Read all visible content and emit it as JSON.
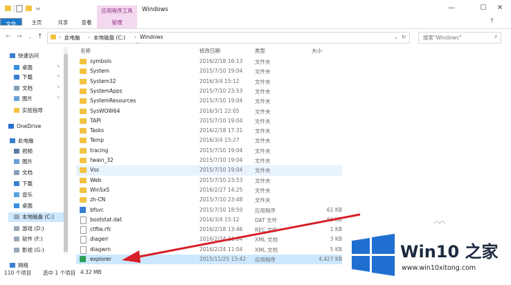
{
  "window": {
    "title": "Windows",
    "context_group": "应用程序工具",
    "minimize": "—",
    "maximize": "☐",
    "close": "✕"
  },
  "ribbon": {
    "tabs": [
      "文件",
      "主页",
      "共享",
      "查看",
      "管理"
    ]
  },
  "address": {
    "crumbs": [
      "此电脑",
      "本地磁盘 (C:)",
      "Windows"
    ],
    "search_placeholder": "搜索\"Windows\""
  },
  "nav": {
    "items": [
      {
        "label": "快速访问",
        "icon": "star-icon"
      },
      {
        "label": "桌面",
        "icon": "desktop-icon"
      },
      {
        "label": "下载",
        "icon": "download-icon"
      },
      {
        "label": "文档",
        "icon": "document-icon"
      },
      {
        "label": "图片",
        "icon": "picture-icon"
      },
      {
        "label": "实验指导",
        "icon": "folder-icon"
      },
      {
        "label": "OneDrive",
        "icon": "cloud-icon"
      },
      {
        "label": "此电脑",
        "icon": "computer-icon"
      },
      {
        "label": "视频",
        "icon": "video-icon"
      },
      {
        "label": "图片",
        "icon": "picture-icon"
      },
      {
        "label": "文档",
        "icon": "document-icon"
      },
      {
        "label": "下载",
        "icon": "download-icon"
      },
      {
        "label": "音乐",
        "icon": "music-icon"
      },
      {
        "label": "桌面",
        "icon": "desktop-icon"
      },
      {
        "label": "本地磁盘 (C:)",
        "icon": "drive-icon"
      },
      {
        "label": "游戏 (D:)",
        "icon": "drive-icon"
      },
      {
        "label": "软件 (F:)",
        "icon": "drive-icon"
      },
      {
        "label": "影视 (G:)",
        "icon": "drive-icon"
      },
      {
        "label": "网络",
        "icon": "network-icon"
      }
    ]
  },
  "columns": {
    "name": "名称",
    "date": "修改日期",
    "type": "类型",
    "size": "大小"
  },
  "files": [
    {
      "name": "symbols",
      "date": "2016/2/18 16:13",
      "type": "文件夹",
      "size": "",
      "kind": "folder"
    },
    {
      "name": "System",
      "date": "2015/7/10 19:04",
      "type": "文件夹",
      "size": "",
      "kind": "folder"
    },
    {
      "name": "System32",
      "date": "2016/3/4 15:12",
      "type": "文件夹",
      "size": "",
      "kind": "folder"
    },
    {
      "name": "SystemApps",
      "date": "2015/7/10 23:53",
      "type": "文件夹",
      "size": "",
      "kind": "folder"
    },
    {
      "name": "SystemResources",
      "date": "2015/7/10 19:04",
      "type": "文件夹",
      "size": "",
      "kind": "folder"
    },
    {
      "name": "SysWOW64",
      "date": "2016/3/1 22:05",
      "type": "文件夹",
      "size": "",
      "kind": "folder"
    },
    {
      "name": "TAPI",
      "date": "2015/7/10 19:04",
      "type": "文件夹",
      "size": "",
      "kind": "folder"
    },
    {
      "name": "Tasks",
      "date": "2016/2/18 17:31",
      "type": "文件夹",
      "size": "",
      "kind": "folder"
    },
    {
      "name": "Temp",
      "date": "2016/3/4 15:27",
      "type": "文件夹",
      "size": "",
      "kind": "folder"
    },
    {
      "name": "tracing",
      "date": "2015/7/10 19:04",
      "type": "文件夹",
      "size": "",
      "kind": "folder"
    },
    {
      "name": "twain_32",
      "date": "2015/7/10 19:04",
      "type": "文件夹",
      "size": "",
      "kind": "folder"
    },
    {
      "name": "Vss",
      "date": "2015/7/10 19:04",
      "type": "文件夹",
      "size": "",
      "kind": "folder",
      "state": "hover"
    },
    {
      "name": "Web",
      "date": "2015/7/10 23:53",
      "type": "文件夹",
      "size": "",
      "kind": "folder"
    },
    {
      "name": "WinSxS",
      "date": "2016/2/27 14:25",
      "type": "文件夹",
      "size": "",
      "kind": "folder"
    },
    {
      "name": "zh-CN",
      "date": "2015/7/10 23:48",
      "type": "文件夹",
      "size": "",
      "kind": "folder"
    },
    {
      "name": "bfsvc",
      "date": "2015/7/10 18:59",
      "type": "应用程序",
      "size": "61 KB",
      "kind": "exe"
    },
    {
      "name": "bootstat.dat",
      "date": "2016/3/4 15:12",
      "type": "DAT 文件",
      "size": "66 KB",
      "kind": "file"
    },
    {
      "name": "ctfile.rfc",
      "date": "2016/2/18 13:46",
      "type": "REC 文件",
      "size": "1 KB",
      "kind": "file"
    },
    {
      "name": "diagerr",
      "date": "2016/2/24 11:04",
      "type": "XML 文档",
      "size": "3 KB",
      "kind": "file"
    },
    {
      "name": "diagwrn",
      "date": "2016/2/24 11:04",
      "type": "XML 文档",
      "size": "5 KB",
      "kind": "file"
    },
    {
      "name": "explorer",
      "date": "2015/11/25 13:42",
      "type": "应用程序",
      "size": "4,427 KB",
      "kind": "explorer",
      "state": "selected"
    }
  ],
  "status": {
    "count": "110 个项目",
    "selected": "选中 1 个项目",
    "size": "4.32 MB"
  },
  "watermark": {
    "brand": "Win10 之家",
    "url": "www.win10xitong.com"
  },
  "colors": {
    "accent": "#1979ca",
    "selection": "#cce8ff",
    "context": "#f3d8ef",
    "arrow": "#d81e27",
    "folder": "#f3c242"
  }
}
